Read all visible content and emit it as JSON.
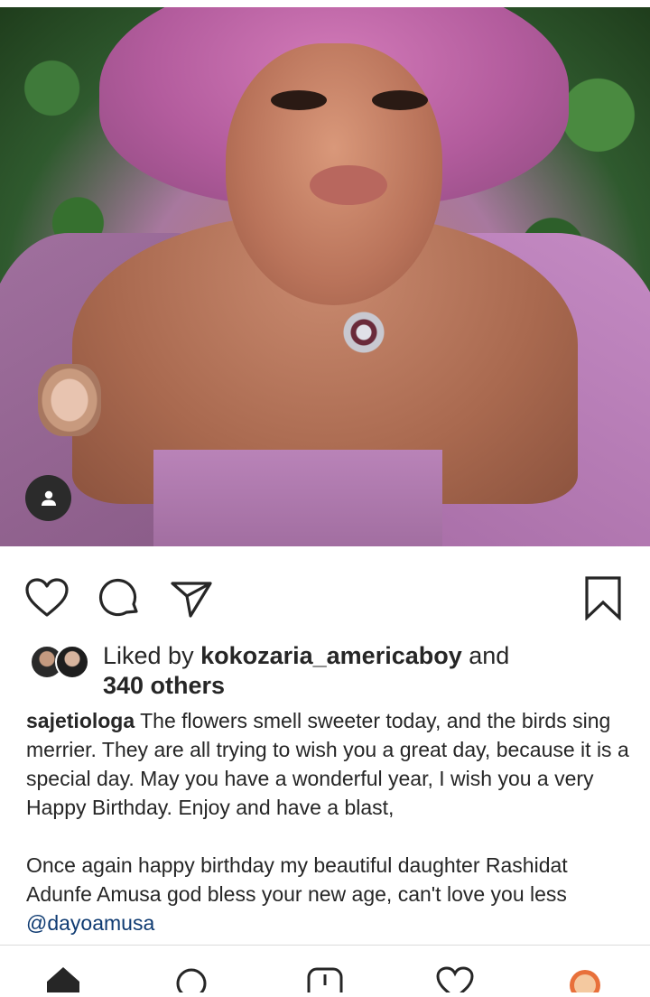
{
  "post": {
    "image_alt_icon": "user-tag-icon"
  },
  "actions": {
    "like_icon": "heart-icon",
    "comment_icon": "comment-icon",
    "share_icon": "send-icon",
    "save_icon": "bookmark-icon"
  },
  "likes": {
    "prefix": "Liked by ",
    "user": "kokozaria_americaboy",
    "conj": " and",
    "others": "340 others"
  },
  "caption": {
    "username": "sajetiologa",
    "para1": " The flowers smell sweeter today, and the birds sing merrier. They are all trying to wish you a great day, because it is a special day. May you have a wonderful year, I wish you a very Happy Birthday. Enjoy and have a blast,",
    "para2": "Once again happy birthday my beautiful daughter Rashidat Adunfe Amusa god bless your new age, can't love you less ",
    "mention": "@dayoamusa"
  },
  "bottom_nav": {
    "items": [
      "home-icon",
      "search-icon",
      "add-icon",
      "activity-icon",
      "profile-icon"
    ]
  },
  "colors": {
    "text": "#262626",
    "mention": "#0f3b72",
    "divider": "#dbdbdb"
  }
}
